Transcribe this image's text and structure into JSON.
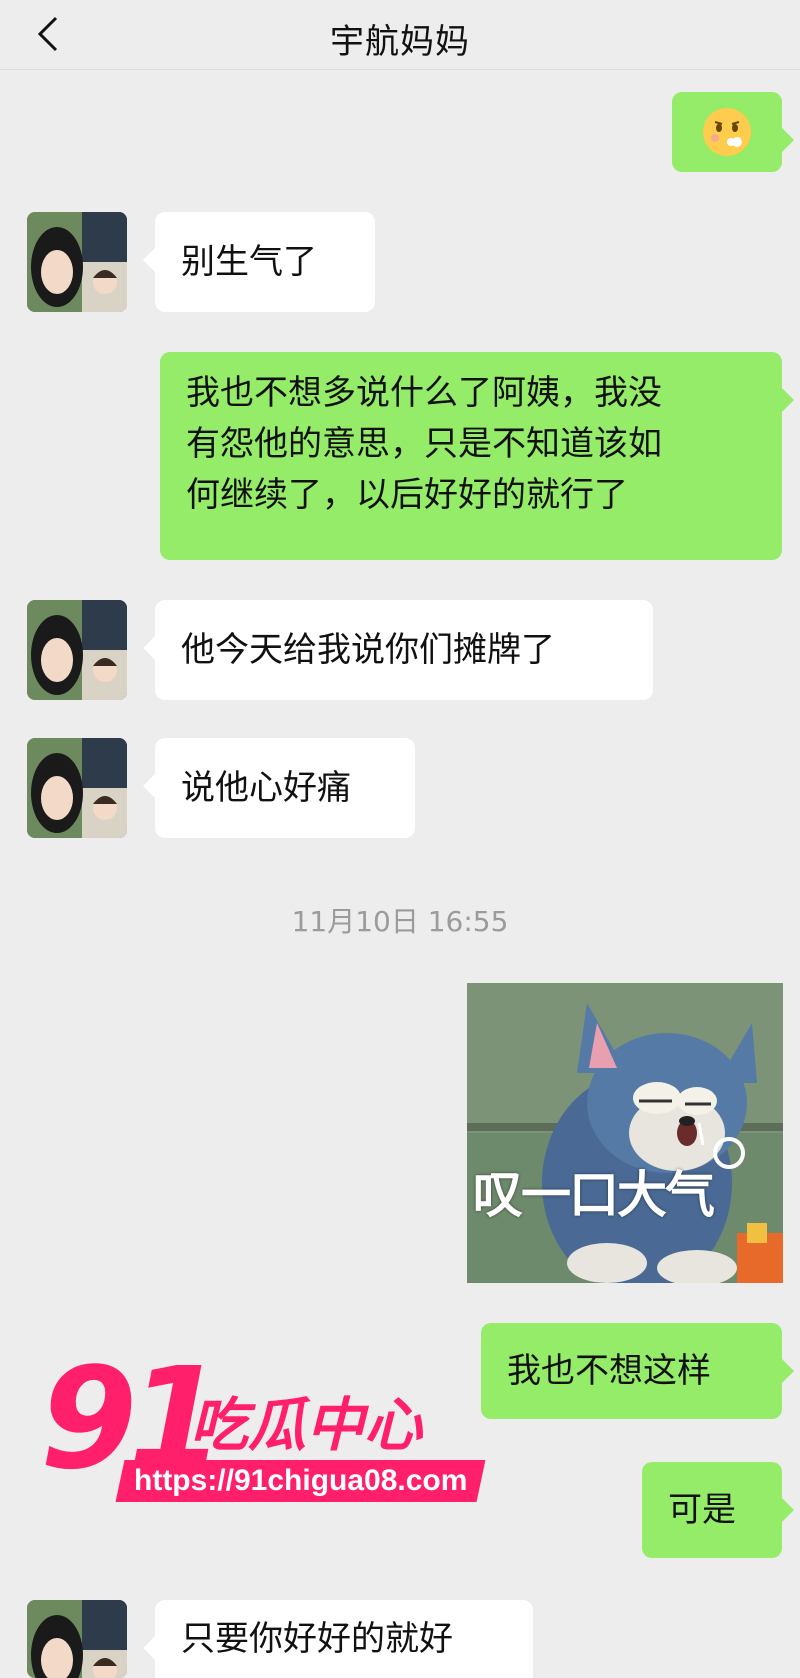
{
  "header": {
    "title": "宇航妈妈",
    "back_icon": "chevron-left-icon"
  },
  "messages": [
    {
      "side": "out",
      "type": "emoji",
      "emoji": "pouting-face-icon"
    },
    {
      "side": "in",
      "text": "别生气了"
    },
    {
      "side": "out",
      "lines": [
        "我也不想多说什么了阿姨，我没",
        "有怨他的意思，只是不知道该如",
        "何继续了，以后好好的就行了"
      ]
    },
    {
      "side": "in",
      "text": "他今天给我说你们摊牌了"
    },
    {
      "side": "in",
      "text": "说他心好痛"
    },
    {
      "side": "out",
      "type": "sticker",
      "caption": "叹一口大气"
    },
    {
      "side": "out",
      "text": "我也不想这样"
    },
    {
      "side": "out",
      "text": "可是"
    },
    {
      "side": "in",
      "text": "只要你好好的就好"
    }
  ],
  "timestamp": "11月10日 16:55",
  "watermark": {
    "number": "91",
    "name": "吃瓜中心",
    "url": "https://91chigua08.com"
  },
  "colors": {
    "out_bubble": "#95ec69",
    "in_bubble": "#ffffff",
    "background": "#ededed",
    "watermark": "#ff1f6b"
  }
}
